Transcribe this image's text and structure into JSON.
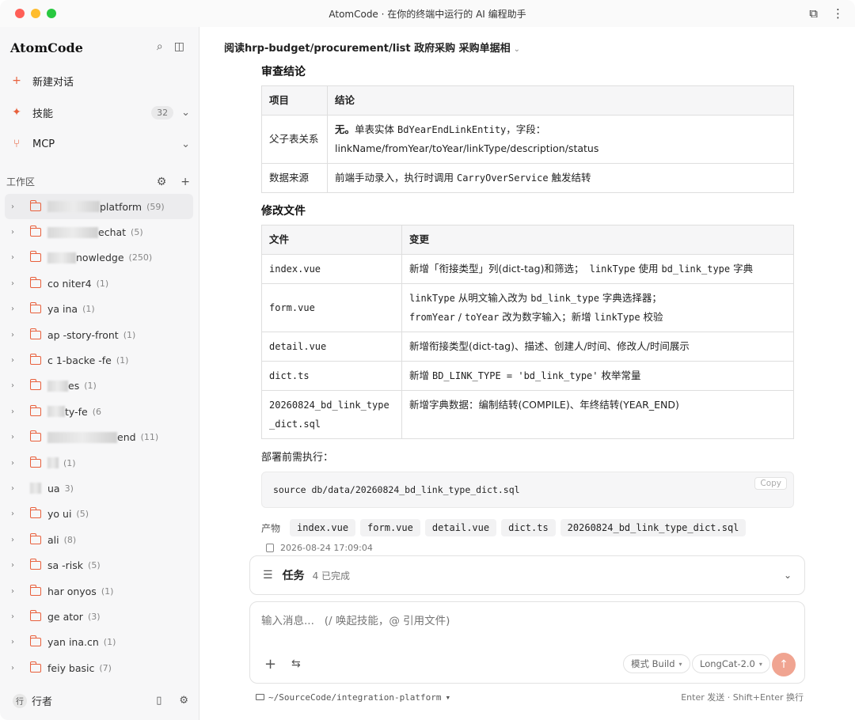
{
  "window": {
    "title": "AtomCode · 在你的终端中运行的 AI 编程助手"
  },
  "sidebar": {
    "brand": "AtomCode",
    "nav": {
      "new_chat": "新建对话",
      "skills": "技能",
      "skills_count": "32",
      "mcp": "MCP"
    },
    "workspace_label": "工作区",
    "workspaces": [
      {
        "name": "platform",
        "count": "(59)"
      },
      {
        "name": "echat",
        "count": "(5)"
      },
      {
        "name": "nowledge",
        "count": "(250)"
      },
      {
        "name": "co niter4",
        "count": "(1)"
      },
      {
        "name": "ya ina",
        "count": "(1)"
      },
      {
        "name": "ap -story-front",
        "count": "(1)"
      },
      {
        "name": "c 1-backe -fe",
        "count": "(1)"
      },
      {
        "name": "es",
        "count": "(1)"
      },
      {
        "name": "ty-fe",
        "count": "(6"
      },
      {
        "name": "end",
        "count": "(11)"
      },
      {
        "name": "",
        "count": "(1)"
      },
      {
        "name": "ua",
        "count": "3)"
      },
      {
        "name": "yo ui",
        "count": "(5)"
      },
      {
        "name": "ali",
        "count": "(8)"
      },
      {
        "name": "sa -risk",
        "count": "(5)"
      },
      {
        "name": "har onyos",
        "count": "(1)"
      },
      {
        "name": "ge ator",
        "count": "(3)"
      },
      {
        "name": "yan ina.cn",
        "count": "(1)"
      },
      {
        "name": "feiy basic",
        "count": "(7)"
      }
    ],
    "user": {
      "avatar": "行",
      "name": "行者"
    }
  },
  "main": {
    "breadcrumb": "阅读hrp-budget/procurement/list 政府采购 采购单据相",
    "review": {
      "heading": "审查结论",
      "headers": [
        "项目",
        "结论"
      ],
      "rows": [
        {
          "item": "父子表关系",
          "c1": "无。",
          "c2": "单表实体 ",
          "c3": "BdYearEndLinkEntity",
          "c4": "，字段：",
          "c5": "linkName/fromYear/toYear/linkType/description/status"
        },
        {
          "item": "数据来源",
          "c1": "前端手动录入，执行时调用 ",
          "c2": "CarryOverService",
          "c3": " 触发结转"
        }
      ]
    },
    "files": {
      "heading": "修改文件",
      "headers": [
        "文件",
        "变更"
      ],
      "rows": [
        {
          "file": "index.vue",
          "change": [
            "新增「衔接类型」列(dict-tag)和筛选；",
            " linkType",
            " 使用 ",
            "bd_link_type",
            " 字典"
          ]
        },
        {
          "file": "form.vue",
          "change": [
            "linkType",
            " 从明文输入改为 ",
            "bd_link_type",
            " 字典选择器；",
            "fromYear",
            " / ",
            "toYear",
            " 改为数字输入；新增 ",
            "linkType",
            " 校验"
          ]
        },
        {
          "file": "detail.vue",
          "change": [
            "新增衔接类型(dict-tag)、描述、创建人/时间、修改人/时间展示"
          ]
        },
        {
          "file": "dict.ts",
          "change": [
            "新增 ",
            "BD_LINK_TYPE = 'bd_link_type'",
            " 枚举常量"
          ]
        },
        {
          "file": "20260824_bd_link_type_dict.sql",
          "change": [
            "新增字典数据：编制结转(COMPILE)、年终结转(YEAR_END)"
          ]
        }
      ]
    },
    "deploy_label": "部署前需执行：",
    "code": "source db/data/20260824_bd_link_type_dict.sql",
    "copy_label": "Copy",
    "artifacts_label": "产物",
    "artifacts": [
      "index.vue",
      "form.vue",
      "detail.vue",
      "dict.ts",
      "20260824_bd_link_type_dict.sql"
    ],
    "timestamp": "2026-08-24 17:09:04",
    "task": {
      "title": "任务",
      "status": "4 已完成"
    },
    "composer": {
      "placeholder": "输入消息...   (/ 唤起技能，@ 引用文件)",
      "mode": "模式 Build",
      "model": "LongCat-2.0"
    },
    "footer": {
      "path": "~/SourceCode/integration-platform",
      "hint": "Enter 发送 · Shift+Enter 换行"
    }
  }
}
